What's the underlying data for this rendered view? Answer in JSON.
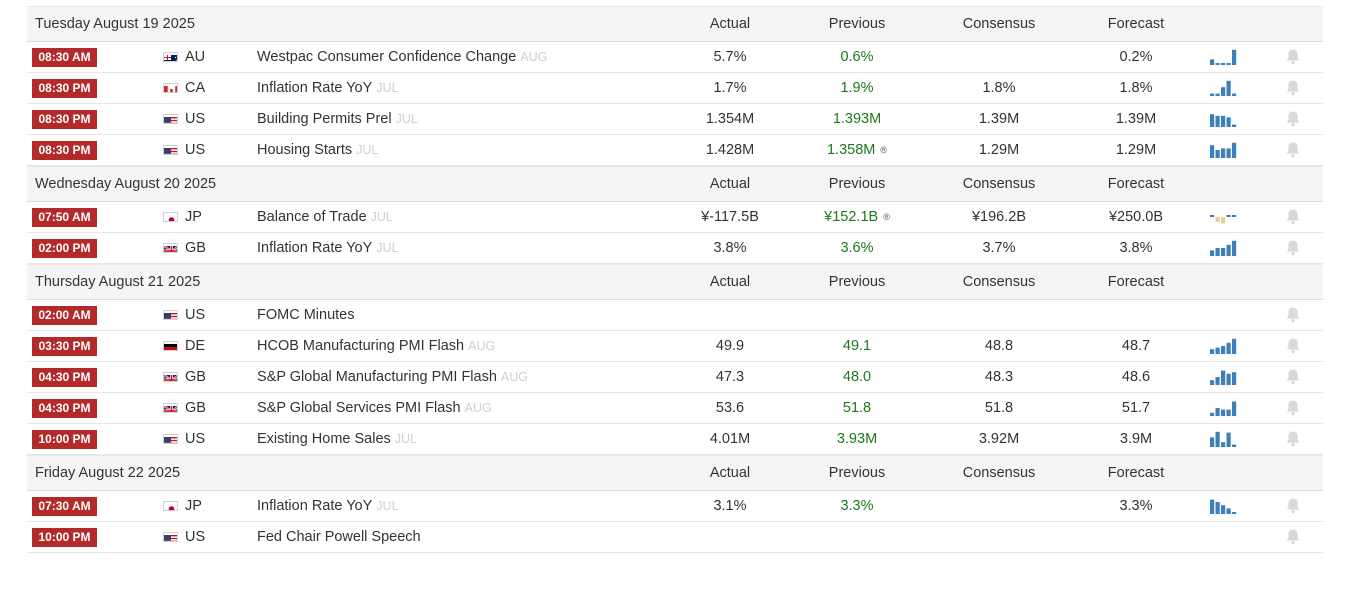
{
  "columns": {
    "actual": "Actual",
    "previous": "Previous",
    "consensus": "Consensus",
    "forecast": "Forecast"
  },
  "colors": {
    "time_badge": "#b22a2a",
    "previous_value": "#1c7a1c",
    "spark_bar": "#3d7fb8",
    "spark_bar_negative": "#e8cf9a",
    "reference": "#cfcfcf"
  },
  "days": [
    {
      "date": "Tuesday August 19 2025",
      "events": [
        {
          "time": "08:30 AM",
          "flag": "au-flag-icon",
          "country": "AU",
          "event": "Westpac Consumer Confidence Change",
          "reference": "AUG",
          "actual": "5.7%",
          "previous": "0.6%",
          "revised": false,
          "consensus": "",
          "forecast": "0.2%",
          "chart": [
            0.35,
            0.12,
            0.12,
            0.12,
            0.95
          ],
          "chart_negative": false
        },
        {
          "time": "08:30 PM",
          "flag": "ca-flag-icon",
          "country": "CA",
          "event": "Inflation Rate YoY",
          "reference": "JUL",
          "actual": "1.7%",
          "previous": "1.9%",
          "revised": false,
          "consensus": "1.8%",
          "forecast": "1.8%",
          "chart": [
            0.15,
            0.15,
            0.55,
            0.95,
            0.15
          ],
          "chart_negative": false
        },
        {
          "time": "08:30 PM",
          "flag": "us-flag-icon",
          "country": "US",
          "event": "Building Permits Prel",
          "reference": "JUL",
          "actual": "1.354M",
          "previous": "1.393M",
          "revised": false,
          "consensus": "1.39M",
          "forecast": "1.39M",
          "chart": [
            0.8,
            0.7,
            0.7,
            0.6,
            0.15
          ],
          "chart_negative": false
        },
        {
          "time": "08:30 PM",
          "flag": "us-flag-icon",
          "country": "US",
          "event": "Housing Starts",
          "reference": "JUL",
          "actual": "1.428M",
          "previous": "1.358M",
          "revised": true,
          "consensus": "1.29M",
          "forecast": "1.29M",
          "chart": [
            0.8,
            0.5,
            0.6,
            0.6,
            0.95
          ],
          "chart_negative": false
        }
      ]
    },
    {
      "date": "Wednesday August 20 2025",
      "events": [
        {
          "time": "07:50 AM",
          "flag": "jp-flag-icon",
          "country": "JP",
          "event": "Balance of Trade",
          "reference": "JUL",
          "actual": "¥-117.5B",
          "previous": "¥152.1B",
          "revised": true,
          "consensus": "¥196.2B",
          "forecast": "¥250.0B",
          "chart": [
            0.12,
            -0.6,
            -0.8,
            0.15,
            0.12
          ],
          "chart_negative": true
        },
        {
          "time": "02:00 PM",
          "flag": "gb-flag-icon",
          "country": "GB",
          "event": "Inflation Rate YoY",
          "reference": "JUL",
          "actual": "3.8%",
          "previous": "3.6%",
          "revised": false,
          "consensus": "3.7%",
          "forecast": "3.8%",
          "chart": [
            0.35,
            0.5,
            0.5,
            0.7,
            0.95
          ],
          "chart_negative": false
        }
      ]
    },
    {
      "date": "Thursday August 21 2025",
      "events": [
        {
          "time": "02:00 AM",
          "flag": "us-flag-icon",
          "country": "US",
          "event": "FOMC Minutes",
          "reference": "",
          "actual": "",
          "previous": "",
          "revised": false,
          "consensus": "",
          "forecast": "",
          "chart": [],
          "chart_negative": false
        },
        {
          "time": "03:30 PM",
          "flag": "de-flag-icon",
          "country": "DE",
          "event": "HCOB Manufacturing PMI Flash",
          "reference": "AUG",
          "actual": "49.9",
          "previous": "49.1",
          "revised": false,
          "consensus": "48.8",
          "forecast": "48.7",
          "chart": [
            0.3,
            0.4,
            0.5,
            0.7,
            0.95
          ],
          "chart_negative": false
        },
        {
          "time": "04:30 PM",
          "flag": "gb-flag-icon",
          "country": "GB",
          "event": "S&P Global Manufacturing PMI Flash",
          "reference": "AUG",
          "actual": "47.3",
          "previous": "48.0",
          "revised": false,
          "consensus": "48.3",
          "forecast": "48.6",
          "chart": [
            0.3,
            0.5,
            0.9,
            0.7,
            0.8
          ],
          "chart_negative": false
        },
        {
          "time": "04:30 PM",
          "flag": "gb-flag-icon",
          "country": "GB",
          "event": "S&P Global Services PMI Flash",
          "reference": "AUG",
          "actual": "53.6",
          "previous": "51.8",
          "revised": false,
          "consensus": "51.8",
          "forecast": "51.7",
          "chart": [
            0.2,
            0.5,
            0.4,
            0.4,
            0.9
          ],
          "chart_negative": false
        },
        {
          "time": "10:00 PM",
          "flag": "us-flag-icon",
          "country": "US",
          "event": "Existing Home Sales",
          "reference": "JUL",
          "actual": "4.01M",
          "previous": "3.93M",
          "revised": false,
          "consensus": "3.92M",
          "forecast": "3.9M",
          "chart": [
            0.6,
            0.95,
            0.3,
            0.9,
            0.15
          ],
          "chart_negative": false
        }
      ]
    },
    {
      "date": "Friday August 22 2025",
      "events": [
        {
          "time": "07:30 AM",
          "flag": "jp-flag-icon",
          "country": "JP",
          "event": "Inflation Rate YoY",
          "reference": "JUL",
          "actual": "3.1%",
          "previous": "3.3%",
          "revised": false,
          "consensus": "",
          "forecast": "3.3%",
          "chart": [
            0.9,
            0.75,
            0.55,
            0.35,
            0.12
          ],
          "chart_negative": false
        },
        {
          "time": "10:00 PM",
          "flag": "us-flag-icon",
          "country": "US",
          "event": "Fed Chair Powell Speech",
          "reference": "",
          "actual": "",
          "previous": "",
          "revised": false,
          "consensus": "",
          "forecast": "",
          "chart": [],
          "chart_negative": false
        }
      ]
    }
  ]
}
